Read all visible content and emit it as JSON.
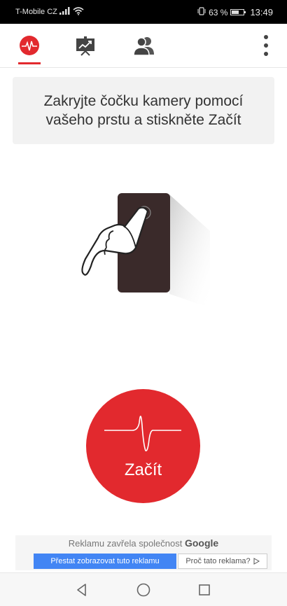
{
  "status_bar": {
    "carrier": "T-Mobile CZ",
    "battery_percent": "63 %",
    "battery_level": 0.63,
    "time": "13:49",
    "icons": [
      "signal-icon",
      "wifi-icon",
      "vibrate-icon",
      "battery-icon"
    ]
  },
  "toolbar": {
    "tabs": [
      {
        "name": "heart-rate",
        "icon": "heartbeat-icon",
        "active": true
      },
      {
        "name": "statistics",
        "icon": "trend-chart-icon",
        "active": false
      },
      {
        "name": "community",
        "icon": "users-icon",
        "active": false
      }
    ],
    "menu_icon": "more-vertical-icon"
  },
  "instruction": {
    "text": "Zakryjte čočku kamery pomocí vašeho prstu a stiskněte Začít"
  },
  "illustration": {
    "icon": "finger-on-phone-camera-icon"
  },
  "start_button": {
    "label": "Začít",
    "icon": "heartbeat-wave-icon"
  },
  "ad": {
    "closed_text": "Reklamu zavřela společnost",
    "closed_brand": "Google",
    "stop_label": "Přestat zobrazovat tuto reklamu",
    "why_label": "Proč tato reklama?",
    "why_icon": "adchoices-icon"
  },
  "colors": {
    "accent": "#e2292e",
    "ad_button": "#4285f4"
  },
  "nav": {
    "icons": [
      "back-icon",
      "home-icon",
      "recents-icon"
    ]
  }
}
